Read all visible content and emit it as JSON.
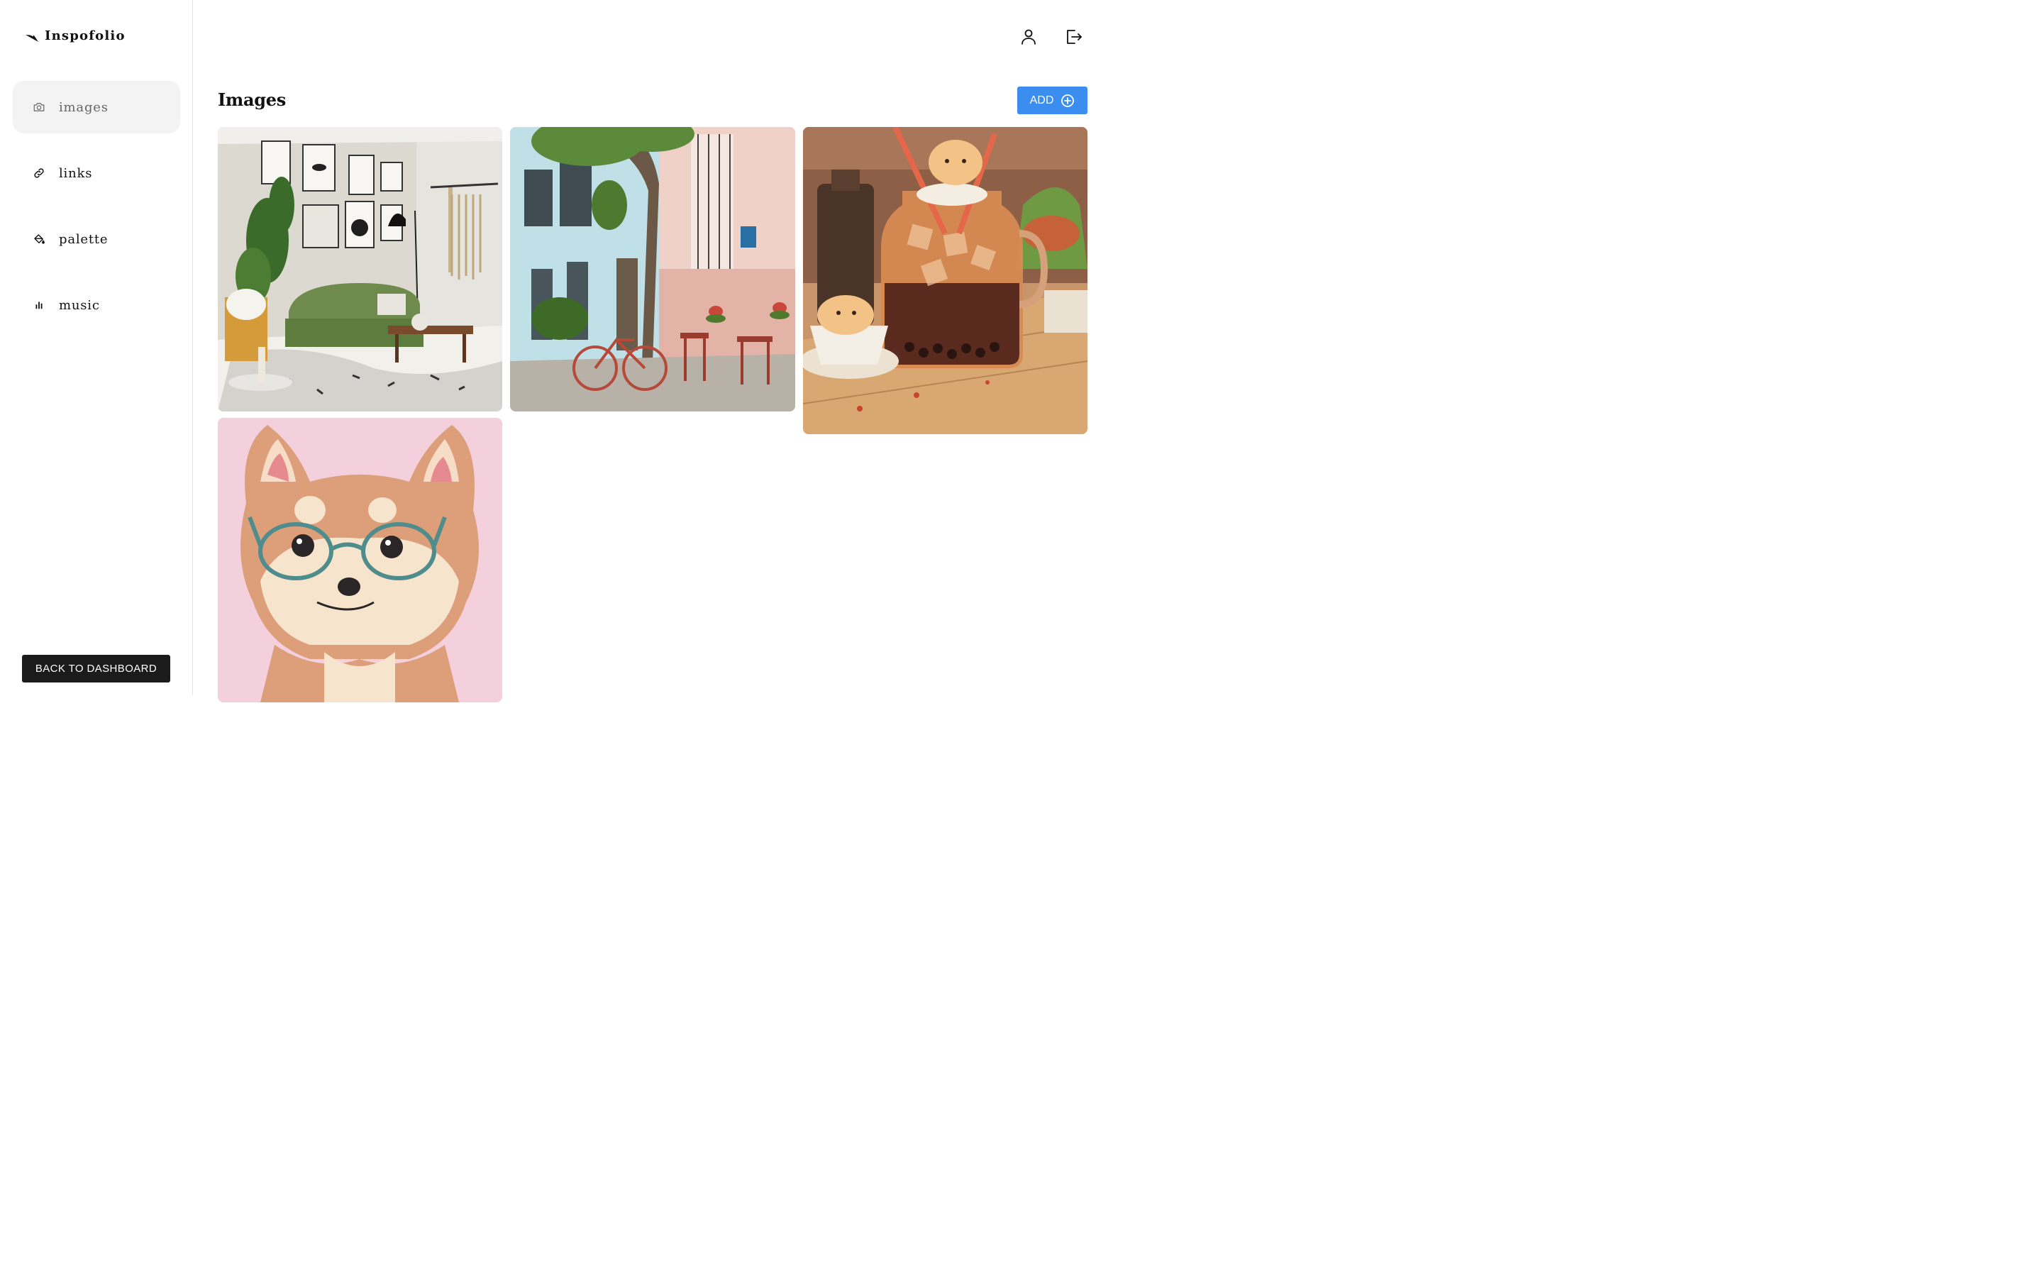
{
  "brand": {
    "name": "Inspofolio",
    "icon": "quill-icon"
  },
  "sidebar": {
    "items": [
      {
        "label": "images",
        "icon": "camera-icon",
        "active": true
      },
      {
        "label": "links",
        "icon": "link-icon",
        "active": false
      },
      {
        "label": "palette",
        "icon": "paint-bucket-icon",
        "active": false
      },
      {
        "label": "music",
        "icon": "bar-chart-icon",
        "active": false
      }
    ],
    "back_label": "BACK TO DASHBOARD"
  },
  "header": {
    "profile_icon": "user-icon",
    "logout_icon": "logout-icon"
  },
  "main": {
    "title": "Images",
    "add_label": "ADD",
    "images": [
      {
        "subject": "living-room-interior"
      },
      {
        "subject": "street-cafe-bicycle"
      },
      {
        "subject": "iced-tea-jar-illustration"
      },
      {
        "subject": "shiba-with-glasses-illustration"
      }
    ]
  },
  "colors": {
    "accent": "#3b8df0",
    "dark_button": "#1b1b1b",
    "active_nav_bg": "#f3f3f3",
    "border": "#e4e4e4"
  }
}
